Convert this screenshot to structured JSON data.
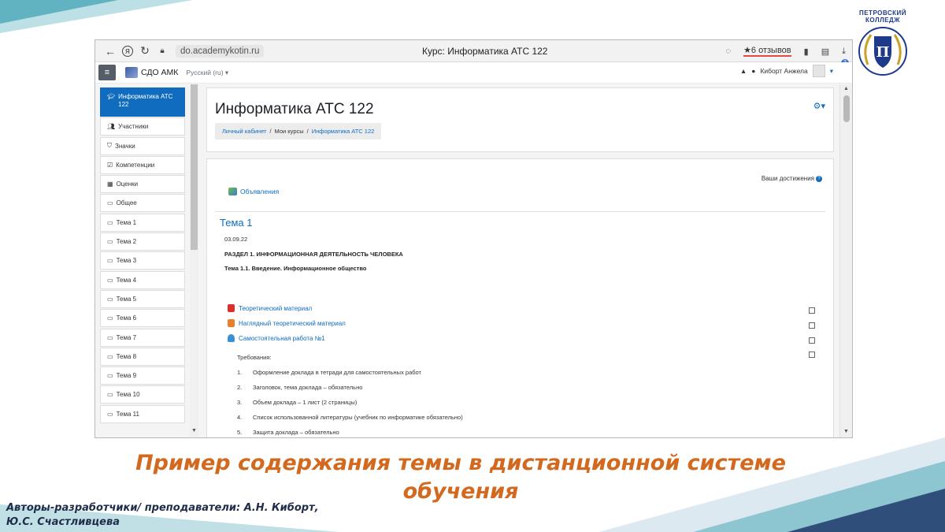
{
  "browser": {
    "url": "do.academykotin.ru",
    "tab_title": "Курс: Информатика АТС 122",
    "reviews": "★6 отзывов",
    "downloads_badge": "3"
  },
  "moodle_nav": {
    "site_name": "СДО АМК",
    "language": "Русский (ru) ▾",
    "user_name": "Киборт Анжела"
  },
  "logo": {
    "line1": "ПЕТРОВСКИЙ",
    "line2": "КОЛЛЕДЖ"
  },
  "left_nav": {
    "items": [
      {
        "label": "Информатика АТС 122",
        "icon": "graduation-cap-icon",
        "active": true
      },
      {
        "label": "Участники",
        "icon": "users-icon"
      },
      {
        "label": "Значки",
        "icon": "shield-icon"
      },
      {
        "label": "Компетенции",
        "icon": "checkbox-icon"
      },
      {
        "label": "Оценки",
        "icon": "table-icon"
      },
      {
        "label": "Общее",
        "icon": "folder-icon"
      },
      {
        "label": "Тема 1",
        "icon": "folder-icon"
      },
      {
        "label": "Тема 2",
        "icon": "folder-icon"
      },
      {
        "label": "Тема 3",
        "icon": "folder-icon"
      },
      {
        "label": "Тема 4",
        "icon": "folder-icon"
      },
      {
        "label": "Тема 5",
        "icon": "folder-icon"
      },
      {
        "label": "Тема 6",
        "icon": "folder-icon"
      },
      {
        "label": "Тема 7",
        "icon": "folder-icon"
      },
      {
        "label": "Тема 8",
        "icon": "folder-icon"
      },
      {
        "label": "Тема 9",
        "icon": "folder-icon"
      },
      {
        "label": "Тема 10",
        "icon": "folder-icon"
      },
      {
        "label": "Тема 11",
        "icon": "folder-icon"
      }
    ]
  },
  "header": {
    "course_title": "Информатика АТС 122",
    "breadcrumb": [
      "Личный кабинет",
      "Мои курсы",
      "Информатика АТС 122"
    ]
  },
  "content": {
    "achievements": "Ваши достижения",
    "announcements": "Объявления",
    "topic_title": "Тема 1",
    "date": "03.09.22",
    "section_heading": "РАЗДЕЛ 1. ИНФОРМАЦИОННАЯ ДЕЯТЕЛЬНОСТЬ ЧЕЛОВЕКА",
    "subtopic": "Тема 1.1. Введение. Информационное общество",
    "activities": [
      {
        "label": "Теоретический материал",
        "icon": "pdf-icon",
        "color": "#d9302c"
      },
      {
        "label": "Наглядный теоретический материал",
        "icon": "presentation-icon",
        "color": "#e87f2a"
      },
      {
        "label": "Самостоятельная работа №1",
        "icon": "assignment-icon",
        "color": "#3a8fd6"
      }
    ],
    "requirements_label": "Требования:",
    "requirements": [
      {
        "n": "1.",
        "text": "Оформление доклада в тетради для самостоятельных работ"
      },
      {
        "n": "2.",
        "text": "Заголовок, тема доклада – обязательно"
      },
      {
        "n": "3.",
        "text": "Объем доклада – 1 лист (2 страницы)"
      },
      {
        "n": "4.",
        "text": "Список использованной литературы (учебник по информатике обязательно)"
      },
      {
        "n": "5.",
        "text": "Защита доклада – обязательно"
      }
    ]
  },
  "slide": {
    "title_line1": "Пример содержания темы в дистанционной системе",
    "title_line2": "обучения",
    "authors_line1": "Авторы-разработчики/ преподаватели:  А.Н. Киборт,",
    "authors_line2": "Ю.С. Счастливцева"
  },
  "colors": {
    "accent": "#0f6cbf",
    "title_orange": "#d2691e",
    "deco_teal": "#4aa7b8",
    "deco_navy": "#1f3a6b"
  }
}
